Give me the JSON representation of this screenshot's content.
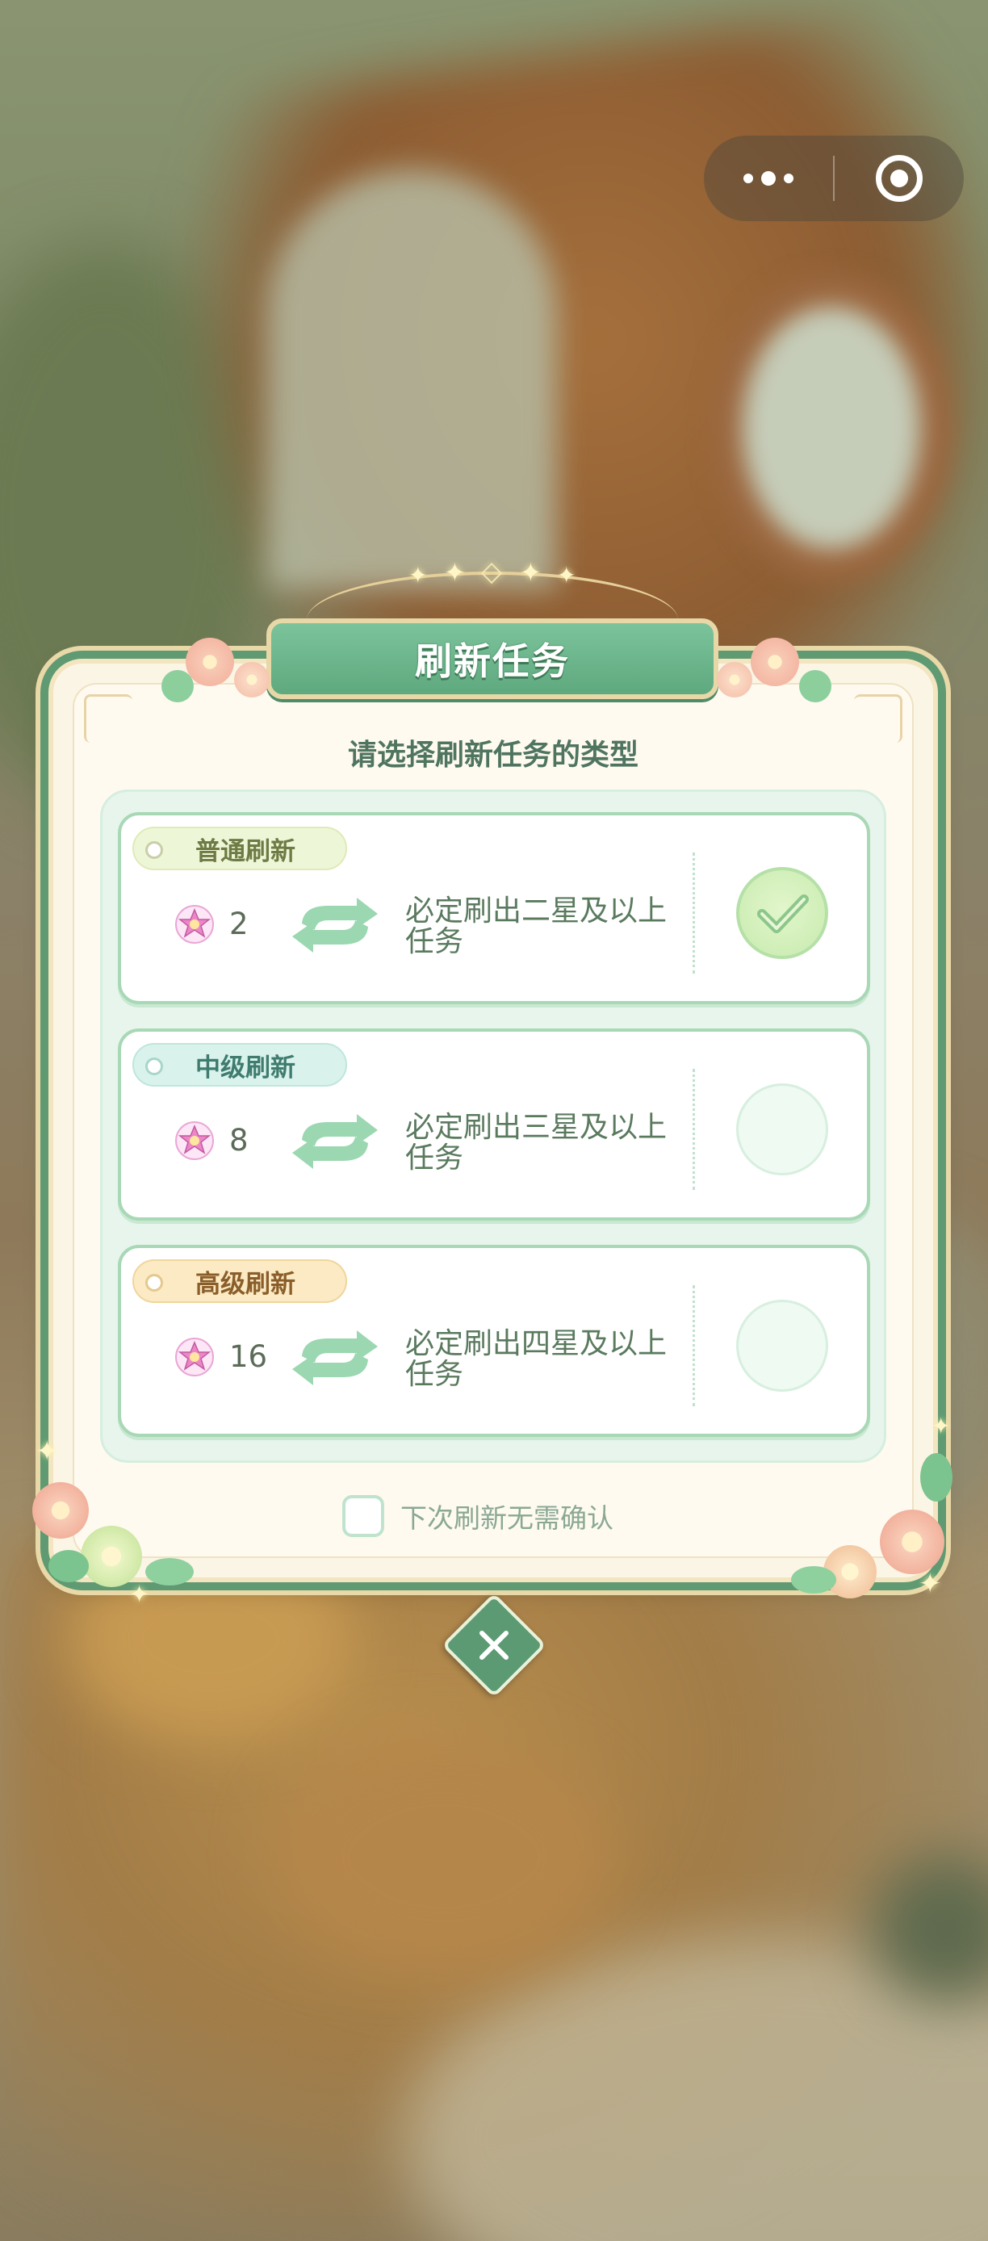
{
  "capsule": {
    "more_icon": "ellipsis-icon",
    "close_icon": "target-circle-icon"
  },
  "dialog": {
    "title": "刷新任务",
    "subtitle": "请选择刷新任务的类型",
    "options": [
      {
        "tag": "普通刷新",
        "cost": "2",
        "description_line1": "必定刷出二星及以上",
        "description_line2": "任务",
        "selected": true
      },
      {
        "tag": "中级刷新",
        "cost": "8",
        "description_line1": "必定刷出三星及以上",
        "description_line2": "任务",
        "selected": false
      },
      {
        "tag": "高级刷新",
        "cost": "16",
        "description_line1": "必定刷出四星及以上",
        "description_line2": "任务",
        "selected": false
      }
    ],
    "skip_confirm_label": "下次刷新无需确认",
    "skip_confirm_checked": false
  },
  "colors": {
    "panel_green": "#5f9a72",
    "title_green": "#6bb58b",
    "tag_basic": "#eef6d8",
    "tag_mid": "#d9f3ec",
    "tag_high": "#fbeac4",
    "text_green": "#5a7a5e"
  }
}
